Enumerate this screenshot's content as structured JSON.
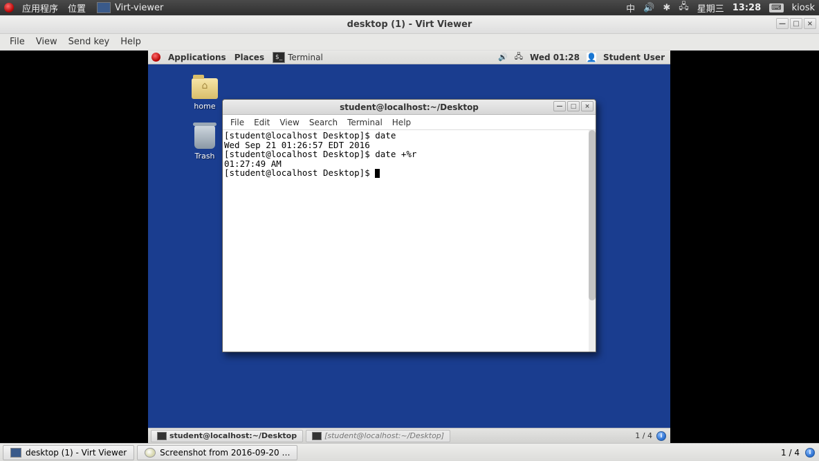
{
  "host": {
    "menu_apps": "应用程序",
    "menu_places": "位置",
    "app_title": "Virt-viewer",
    "ime": "中",
    "clock_day": "星期三",
    "clock_time": "13:28",
    "user": "kiosk"
  },
  "vv": {
    "title": "desktop (1) - Virt Viewer",
    "menu": {
      "file": "File",
      "view": "View",
      "sendkey": "Send key",
      "help": "Help"
    }
  },
  "guest": {
    "panel": {
      "apps": "Applications",
      "places": "Places",
      "terminal": "Terminal",
      "time": "Wed 01:28",
      "user": "Student User"
    },
    "icons": {
      "home": "home",
      "trash": "Trash"
    },
    "term": {
      "title": "student@localhost:~/Desktop",
      "menu": {
        "file": "File",
        "edit": "Edit",
        "view": "View",
        "search": "Search",
        "terminal": "Terminal",
        "help": "Help"
      },
      "lines": [
        "[student@localhost Desktop]$ date",
        "Wed Sep 21 01:26:57 EDT 2016",
        "[student@localhost Desktop]$ date +%r",
        "01:27:49 AM",
        "[student@localhost Desktop]$ "
      ]
    },
    "taskbar": {
      "btn1": "student@localhost:~/Desktop",
      "btn2": "[student@localhost:~/Desktop]",
      "ws": "1 / 4"
    }
  },
  "host_taskbar": {
    "btn1": "desktop (1) - Virt Viewer",
    "btn2": "Screenshot from 2016-09-20 …",
    "ws": "1 / 4"
  }
}
